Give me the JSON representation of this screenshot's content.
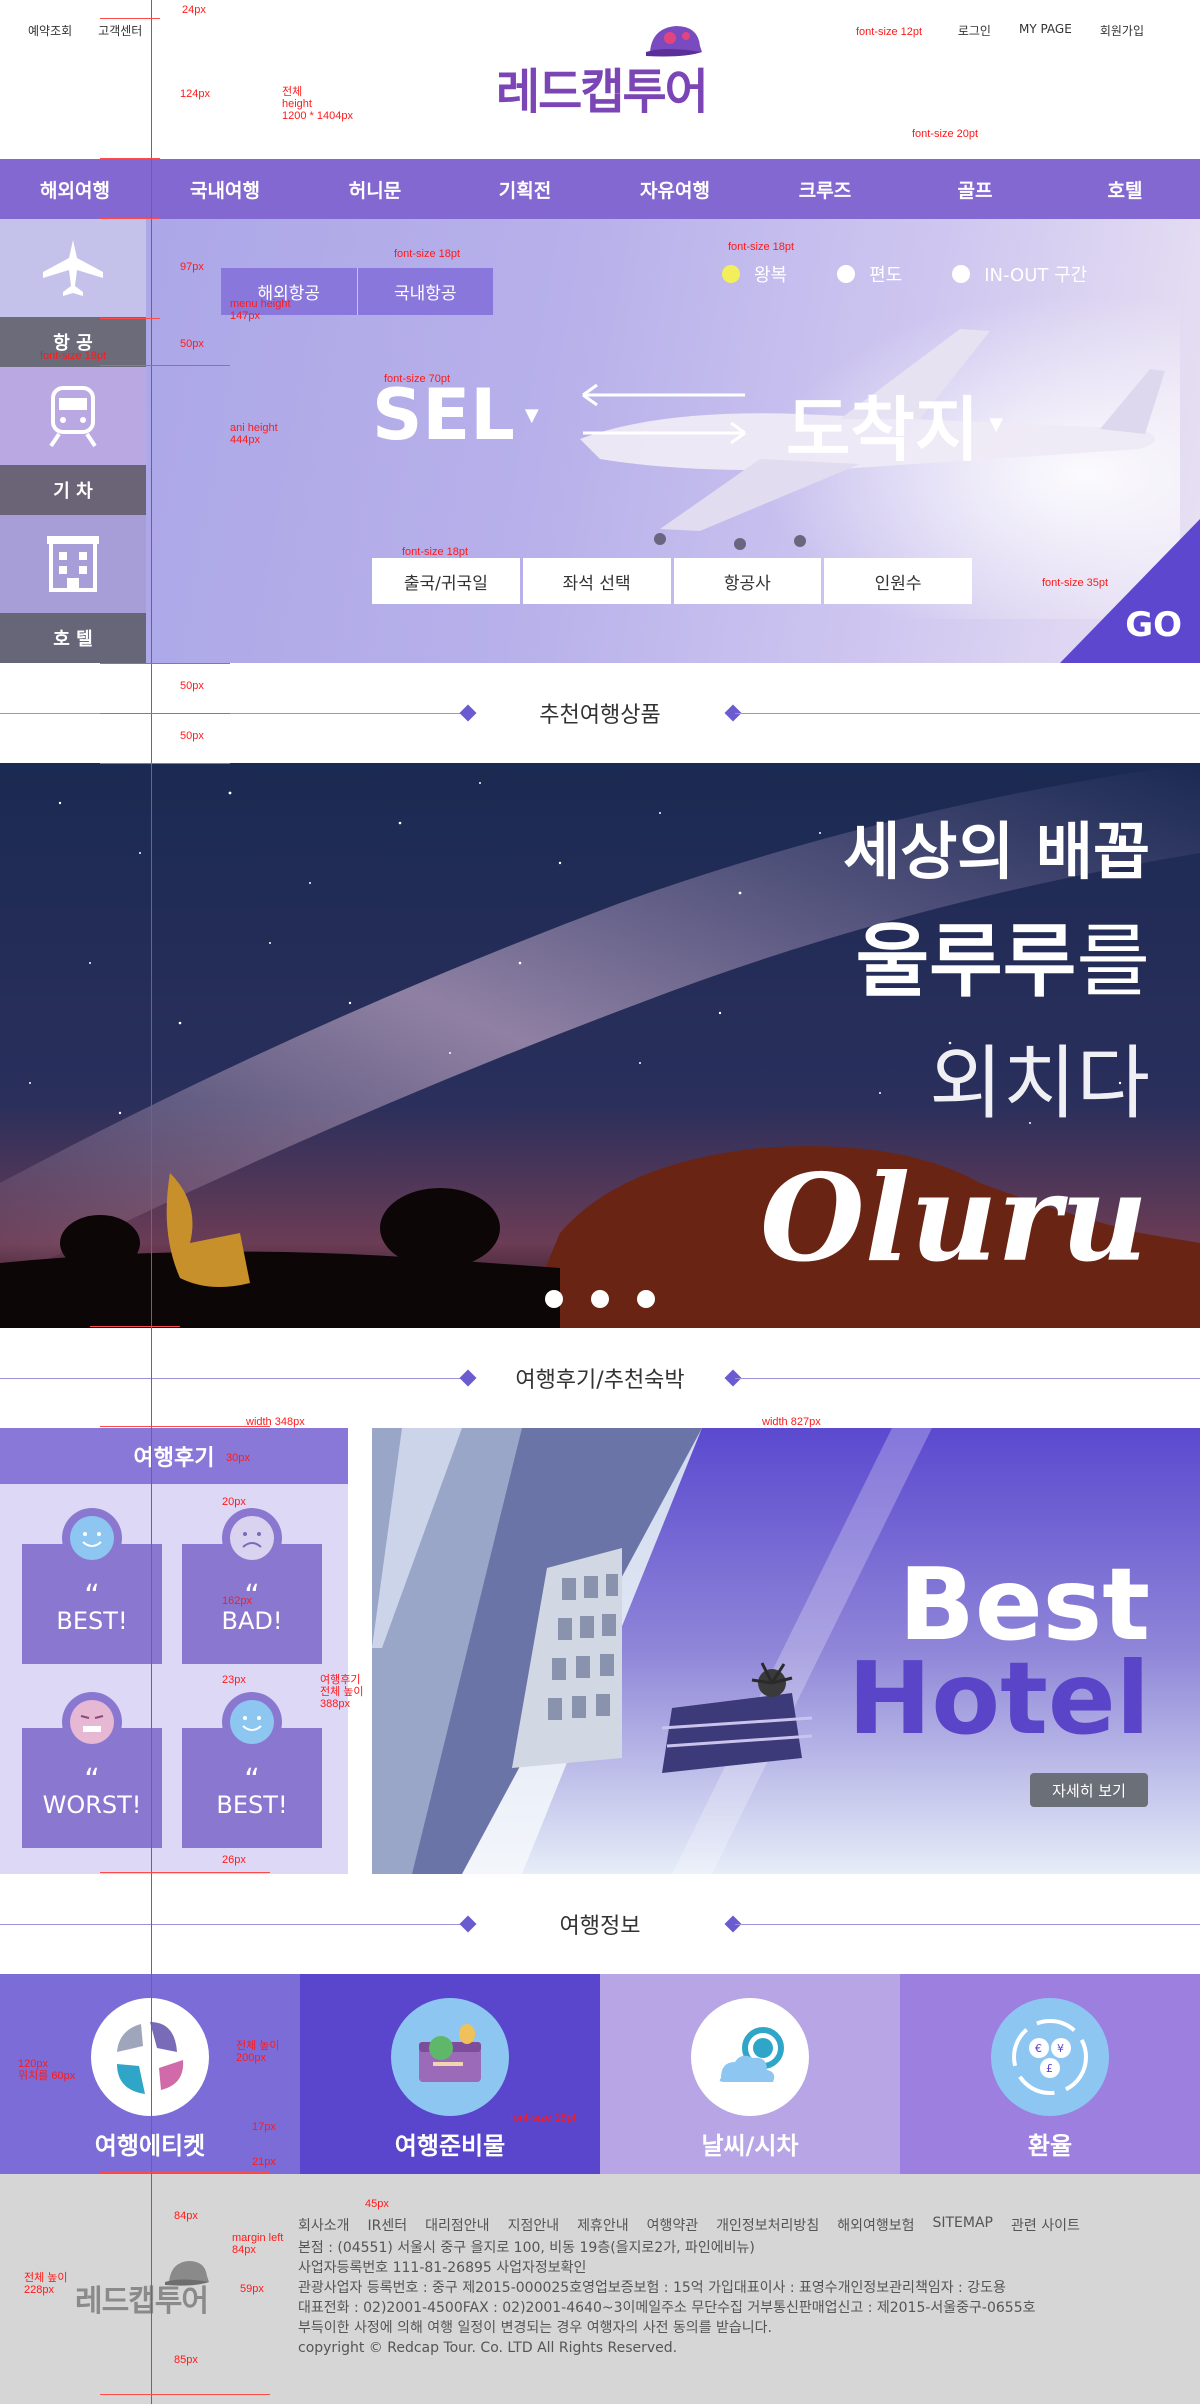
{
  "util_left": [
    "예약조회",
    "고객센터"
  ],
  "util_right": [
    "로그인",
    "MY PAGE",
    "회원가입"
  ],
  "logo_text": "레드캡투어",
  "nav": [
    "해외여행",
    "국내여행",
    "허니문",
    "기획전",
    "자유여행",
    "크루즈",
    "골프",
    "호텔"
  ],
  "side": [
    "항 공",
    "기 차",
    "호 텔"
  ],
  "flight_tabs": [
    "해외항공",
    "국내항공"
  ],
  "trip_types": [
    {
      "label": "왕복",
      "selected": true
    },
    {
      "label": "편도",
      "selected": false
    },
    {
      "label": "IN-OUT 구간",
      "selected": false
    }
  ],
  "origin": "SEL",
  "destination": "도착지",
  "search_options": [
    "출국/귀국일",
    "좌석 선택",
    "항공사",
    "인원수"
  ],
  "go": "GO",
  "section_recommend": "추천여행상품",
  "banner": {
    "line1": "세상의 배꼽",
    "line2_bold": "울루루",
    "line2_rest": "를",
    "line3": "외치다",
    "script": "Oluru"
  },
  "section_review": "여행후기/추천숙박",
  "review": {
    "title": "여행후기",
    "cards": [
      {
        "quote": "“",
        "label": "BEST!",
        "face": "smile"
      },
      {
        "quote": "“",
        "label": "BAD!",
        "face": "sad"
      },
      {
        "quote": "“",
        "label": "WORST!",
        "face": "worst"
      },
      {
        "quote": "“",
        "label": "BEST!",
        "face": "smile"
      }
    ]
  },
  "hotel": {
    "line1": "Best",
    "line2": "Hotel",
    "button": "자세히 보기"
  },
  "section_info": "여행정보",
  "info": [
    {
      "label": "여행에티켓",
      "icon": "etiquette-icon",
      "bg": "#7b6cd8"
    },
    {
      "label": "여행준비물",
      "icon": "suitcase-icon",
      "bg": "#5a46cc"
    },
    {
      "label": "날씨/시차",
      "icon": "weather-icon",
      "bg": "#b7a5e6"
    },
    {
      "label": "환율",
      "icon": "exchange-icon",
      "bg": "#9d7fe0"
    }
  ],
  "footer": {
    "logo": "레드캡투어",
    "links": [
      "회사소개",
      "IR센터",
      "대리점안내",
      "지점안내",
      "제휴안내",
      "여행약관",
      "개인정보처리방침",
      "해외여행보험",
      "SITEMAP",
      "관련 사이트"
    ],
    "lines": [
      "본점 : (04551) 서울시 중구 을지로 100, 비동 19층(을지로2가, 파인에비뉴)",
      "사업자등록번호 111-81-26895   사업자정보확인",
      "관광사업자 등록번호 : 중구 제2015-000025호영업보증보험 : 15억 가입대표이사 : 표영수개인정보관리책임자 : 강도용",
      "대표전화 : 02)2001-4500FAX : 02)2001-4640~3이메일주소 무단수집 거부통신판매업신고 : 제2015-서울중구-0655호",
      "부득이한 사정에 의해 여행 일정이 변경되는 경우 여행자의 사전 동의를 받습니다.",
      "copyright © Redcap Tour. Co. LTD All Rights Reserved."
    ]
  },
  "annotations": {
    "a1": "24px",
    "a2": "124px",
    "a3": "전체\nheight\n1200 * 1404px",
    "a4": "font-size 12pt",
    "a5": "font-size 20pt",
    "a6": "97px",
    "a7": "font-size 18pt",
    "a8": "font-size 18pt",
    "a9": "menu height\n147px",
    "a10": "font-size 18pt",
    "a11": "50px",
    "a12": "font-size 70pt",
    "a13": "ani height\n444px",
    "a14": "font-size 18pt",
    "a15": "font-size 35pt",
    "a16": "50px",
    "a17": "50px",
    "a18": "width 348px",
    "a19": "width 827px",
    "a20": "30px",
    "a21": "20px",
    "a22": "162px",
    "a23": "23px",
    "a24": "여행후기\n전체 높이\n388px",
    "a25": "26px",
    "a26": "120px\n위치를 60px",
    "a27": "전체 높이\n200px",
    "a28": "17px",
    "a29": "font-size 18pt",
    "a30": "21px",
    "a31": "45px",
    "a32": "84px",
    "a33": "margin left\n84px",
    "a34": "전체 높이\n228px",
    "a35": "59px",
    "a36": "85px"
  }
}
